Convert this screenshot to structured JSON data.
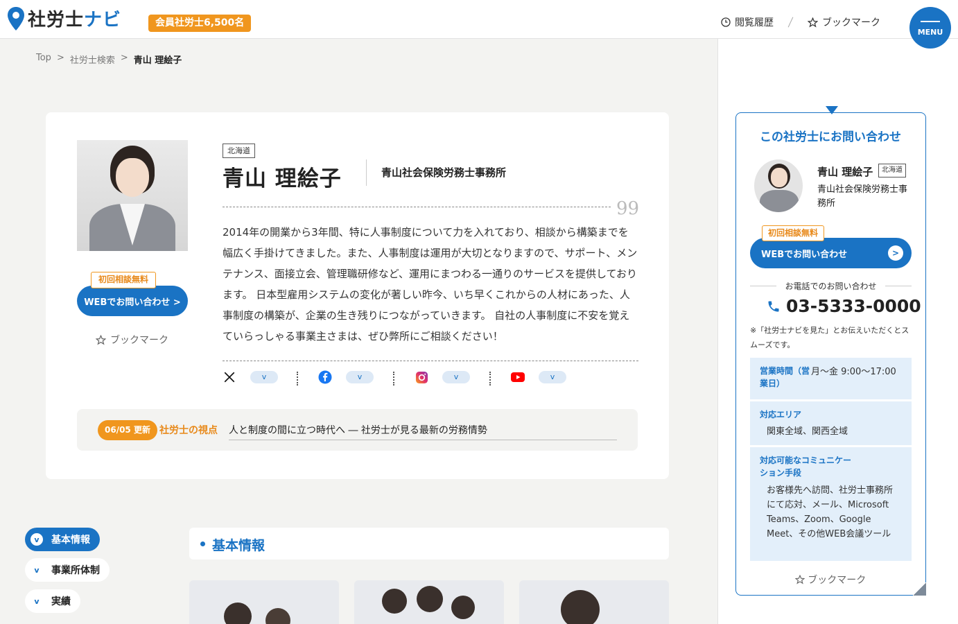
{
  "header": {
    "logo_main": "社労士",
    "logo_navi": "ナビ",
    "member_badge": "会員社労士6,500名",
    "history_label": "閲覧履歴",
    "bookmark_label": "ブックマーク",
    "menu_label": "MENU"
  },
  "breadcrumb": {
    "items": [
      "Top",
      ">",
      "社労士検索",
      ">"
    ],
    "current": "青山 理絵子"
  },
  "profile": {
    "prefecture": "北海道",
    "name": "青山 理絵子",
    "office": "青山社会保険労務士事務所",
    "quote_mark": "99",
    "bio": "2014年の開業から3年間、特に人事制度について力を入れており、相談から構築までを幅広く手掛けてきました。また、人事制度は運用が大切となりますので、サポート、メンテナンス、面接立会、管理職研修など、運用にまつわる一通りのサービスを提供しております。 日本型雇用システムの変化が著しい昨今、いち早くこれからの人材にあった、人事制度の構築が、企業の生き残りにつながっていきます。 自社の人事制度に不安を覚えていらっしゃる事業主さまは、ぜひ弊所にご相談ください！",
    "free_tag": "初回相談無料",
    "web_button": "WEBでお問い合わせ >",
    "bookmark": "ブックマーク",
    "sns_chevron": "v",
    "news": {
      "date": "06/05 更新",
      "category": "社労士の視点",
      "title": "人と制度の間に立つ時代へ ― 社労士が見る最新の労務情勢"
    }
  },
  "left_nav": {
    "items": [
      {
        "label": "基本情報",
        "icon": "v"
      },
      {
        "label": "事業所体制",
        "icon": "v"
      },
      {
        "label": "実績",
        "icon": "v"
      }
    ]
  },
  "section": {
    "title": "基本情報"
  },
  "contact": {
    "title": "この社労士にお問い合わせ",
    "name": "青山 理絵子",
    "prefecture": "北海道",
    "office": "青山社会保険労務士事務所",
    "free_tag": "初回相談無料",
    "web_button": "WEBでお問い合わせ",
    "web_arrow": ">",
    "phone_label": "お電話でのお問い合わせ",
    "phone": "03-5333-0000",
    "note": "※「社労士ナビを見た」とお伝えいただくとスムーズです。",
    "hours_key": "営業時間（営業日）",
    "hours_val": "月〜金 9:00〜17:00",
    "area_key": "対応エリア",
    "area_val": "関東全域、関西全域",
    "comm_key": "対応可能なコミュニケーション手段",
    "comm_val": "お客様先へ訪問、社労士事務所にて応対、メール、Microsoft Teams、Zoom、Google Meet、その他WEB会議ツール",
    "bookmark": "ブックマーク"
  },
  "colors": {
    "brand_blue": "#1a73c4",
    "accent_orange": "#f0961e",
    "info_bg": "#e3effa"
  }
}
